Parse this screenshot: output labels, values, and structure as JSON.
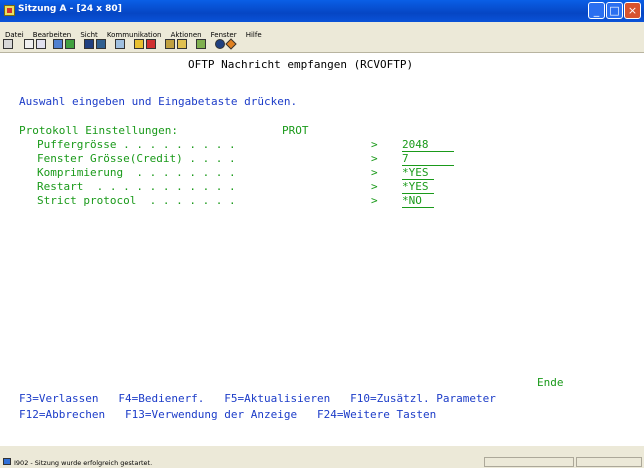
{
  "window": {
    "title": "Sitzung A - [24 x 80]"
  },
  "menu": [
    "Datei",
    "Bearbeiten",
    "Sicht",
    "Kommunikation",
    "Aktionen",
    "Fenster",
    "Hilfe"
  ],
  "toolbar_icons": [
    "print-icon",
    "copy-icon",
    "paste-icon",
    "send-icon",
    "receive-icon",
    "display-icon",
    "color-icon",
    "edit-icon",
    "transfer-icon",
    "transfer2-icon",
    "macro-icon",
    "macro2-icon",
    "keyboard-icon",
    "help-icon",
    "color-wheel-icon"
  ],
  "screen": {
    "title": "OFTP Nachricht empfangen (RCVOFTP)",
    "instruction": "Auswahl eingeben und Eingabetaste drücken.",
    "section_label": "Protokoll Einstellungen:",
    "section_value": "PROT",
    "params": [
      {
        "label": "Puffergrösse . . . . . . . . .",
        "arrow": ">",
        "value": "2048"
      },
      {
        "label": "Fenster Grösse(Credit) . . . .",
        "arrow": ">",
        "value": "7"
      },
      {
        "label": "Komprimierung  . . . . . . . .",
        "arrow": ">",
        "value": "*YES"
      },
      {
        "label": "Restart  . . . . . . . . . . .",
        "arrow": ">",
        "value": "*YES"
      },
      {
        "label": "Strict protocol  . . . . . . .",
        "arrow": ">",
        "value": "*NO"
      }
    ],
    "ende": "Ende",
    "fkeys_line1": "F3=Verlassen   F4=Bedienerf.   F5=Aktualisieren   F10=Zusätzl. Parameter",
    "fkeys_line2": "F12=Abbrechen   F13=Verwendung der Anzeige   F24=Weitere Tasten"
  },
  "status": {
    "text": "I902 - Sitzung wurde erfolgreich gestartet."
  }
}
